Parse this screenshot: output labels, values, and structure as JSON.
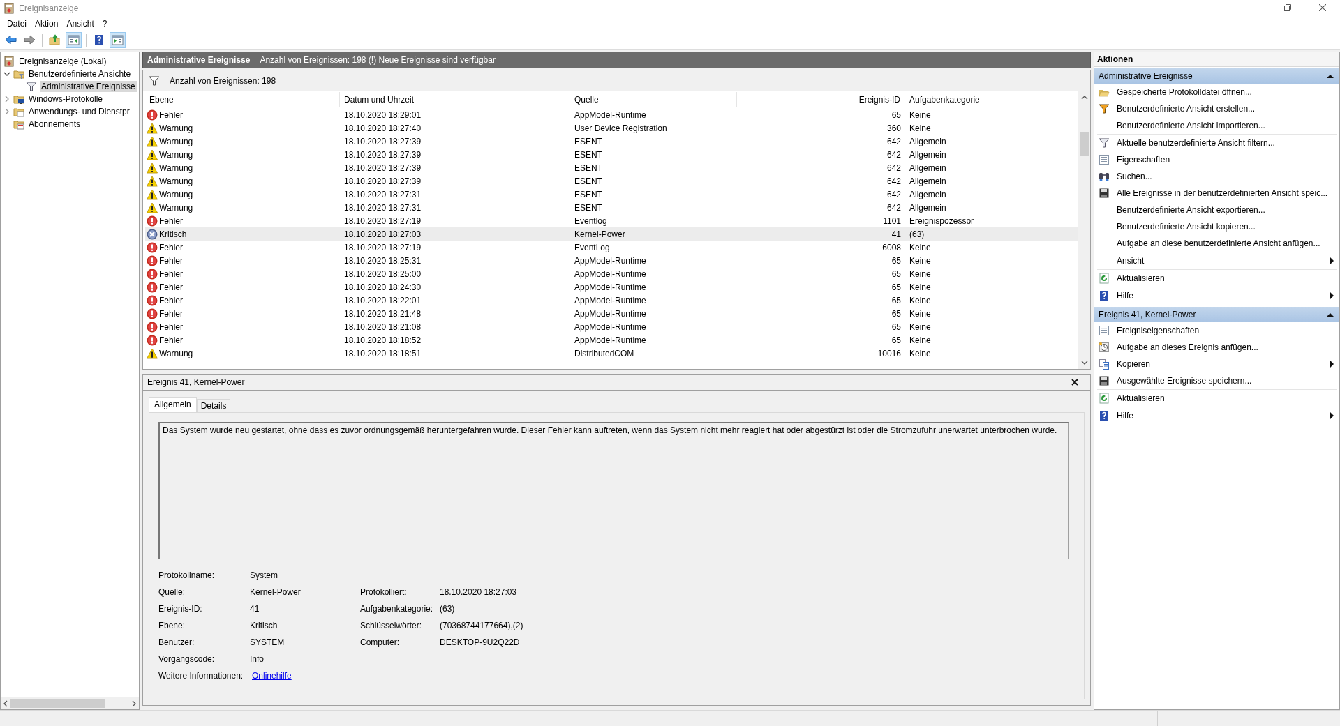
{
  "window": {
    "title": "Ereignisanzeige"
  },
  "menu": [
    "Datei",
    "Aktion",
    "Ansicht",
    "?"
  ],
  "toolbar": [
    {
      "kind": "back",
      "pressed": false
    },
    {
      "kind": "forward",
      "pressed": false
    },
    {
      "kind": "sep"
    },
    {
      "kind": "up-folder",
      "pressed": false
    },
    {
      "kind": "tree-pane",
      "pressed": true
    },
    {
      "kind": "sep"
    },
    {
      "kind": "help",
      "pressed": false
    },
    {
      "kind": "action-pane",
      "pressed": true
    }
  ],
  "tree": [
    {
      "label": "Ereignisanzeige (Lokal)",
      "kind": "log",
      "selected": false,
      "children": [
        {
          "label": "Benutzerdefinierte Ansichte",
          "kind": "folder-filter",
          "expanded": true,
          "selected": false,
          "children": [
            {
              "label": "Administrative Ereignisse",
              "kind": "funnel",
              "selected": true
            }
          ]
        },
        {
          "label": "Windows-Protokolle",
          "kind": "folder-pc",
          "expanded": false,
          "selected": false
        },
        {
          "label": "Anwendungs- und Dienstpr",
          "kind": "folder-doc",
          "expanded": false,
          "selected": false
        },
        {
          "label": "Abonnements",
          "kind": "folder-sub",
          "selected": false
        }
      ]
    }
  ],
  "view_header": {
    "title": "Administrative Ereignisse",
    "info": "Anzahl von Ereignissen: 198 (!) Neue Ereignisse sind verfügbar"
  },
  "filter_bar": {
    "text": "Anzahl von Ereignissen: 198"
  },
  "table": {
    "columns": [
      {
        "label": "Ebene"
      },
      {
        "label": "Datum und Uhrzeit"
      },
      {
        "label": "Quelle"
      },
      {
        "label": "Ereignis-ID"
      },
      {
        "label": "Aufgabenkategorie"
      }
    ],
    "rows": [
      {
        "kind": "error",
        "cells": [
          "Fehler",
          "18.10.2020 18:29:01",
          "AppModel-Runtime",
          "65",
          "Keine"
        ],
        "selected": false
      },
      {
        "kind": "warning",
        "cells": [
          "Warnung",
          "18.10.2020 18:27:40",
          "User Device Registration",
          "360",
          "Keine"
        ],
        "selected": false
      },
      {
        "kind": "warning",
        "cells": [
          "Warnung",
          "18.10.2020 18:27:39",
          "ESENT",
          "642",
          "Allgemein"
        ],
        "selected": false
      },
      {
        "kind": "warning",
        "cells": [
          "Warnung",
          "18.10.2020 18:27:39",
          "ESENT",
          "642",
          "Allgemein"
        ],
        "selected": false
      },
      {
        "kind": "warning",
        "cells": [
          "Warnung",
          "18.10.2020 18:27:39",
          "ESENT",
          "642",
          "Allgemein"
        ],
        "selected": false
      },
      {
        "kind": "warning",
        "cells": [
          "Warnung",
          "18.10.2020 18:27:39",
          "ESENT",
          "642",
          "Allgemein"
        ],
        "selected": false
      },
      {
        "kind": "warning",
        "cells": [
          "Warnung",
          "18.10.2020 18:27:31",
          "ESENT",
          "642",
          "Allgemein"
        ],
        "selected": false
      },
      {
        "kind": "warning",
        "cells": [
          "Warnung",
          "18.10.2020 18:27:31",
          "ESENT",
          "642",
          "Allgemein"
        ],
        "selected": false
      },
      {
        "kind": "error",
        "cells": [
          "Fehler",
          "18.10.2020 18:27:19",
          "Eventlog",
          "1101",
          "Ereignispozessor"
        ],
        "selected": false
      },
      {
        "kind": "critical",
        "cells": [
          "Kritisch",
          "18.10.2020 18:27:03",
          "Kernel-Power",
          "41",
          "(63)"
        ],
        "selected": true
      },
      {
        "kind": "error",
        "cells": [
          "Fehler",
          "18.10.2020 18:27:19",
          "EventLog",
          "6008",
          "Keine"
        ],
        "selected": false
      },
      {
        "kind": "error",
        "cells": [
          "Fehler",
          "18.10.2020 18:25:31",
          "AppModel-Runtime",
          "65",
          "Keine"
        ],
        "selected": false
      },
      {
        "kind": "error",
        "cells": [
          "Fehler",
          "18.10.2020 18:25:00",
          "AppModel-Runtime",
          "65",
          "Keine"
        ],
        "selected": false
      },
      {
        "kind": "error",
        "cells": [
          "Fehler",
          "18.10.2020 18:24:30",
          "AppModel-Runtime",
          "65",
          "Keine"
        ],
        "selected": false
      },
      {
        "kind": "error",
        "cells": [
          "Fehler",
          "18.10.2020 18:22:01",
          "AppModel-Runtime",
          "65",
          "Keine"
        ],
        "selected": false
      },
      {
        "kind": "error",
        "cells": [
          "Fehler",
          "18.10.2020 18:21:48",
          "AppModel-Runtime",
          "65",
          "Keine"
        ],
        "selected": false
      },
      {
        "kind": "error",
        "cells": [
          "Fehler",
          "18.10.2020 18:21:08",
          "AppModel-Runtime",
          "65",
          "Keine"
        ],
        "selected": false
      },
      {
        "kind": "error",
        "cells": [
          "Fehler",
          "18.10.2020 18:18:52",
          "AppModel-Runtime",
          "65",
          "Keine"
        ],
        "selected": false
      },
      {
        "kind": "warning",
        "cells": [
          "Warnung",
          "18.10.2020 18:18:51",
          "DistributedCOM",
          "10016",
          "Keine"
        ],
        "selected": false
      }
    ]
  },
  "details": {
    "title": "Ereignis 41, Kernel-Power",
    "tabs": [
      {
        "label": "Allgemein",
        "selected": true
      },
      {
        "label": "Details",
        "selected": false
      }
    ],
    "description": "Das System wurde neu gestartet, ohne dass es zuvor ordnungsgemäß heruntergefahren wurde. Dieser Fehler kann auftreten, wenn das System nicht mehr reagiert hat oder abgestürzt ist oder die Stromzufuhr unerwartet unterbrochen wurde.",
    "properties": [
      {
        "label": "Protokollname:",
        "value": "System"
      },
      {
        "label": "Quelle:",
        "value": "Kernel-Power",
        "label_2": "Protokolliert:",
        "value_2": "18.10.2020 18:27:03"
      },
      {
        "label": "Ereignis-ID:",
        "value": "41",
        "label_2": "Aufgabenkategorie:",
        "value_2": "(63)"
      },
      {
        "label": "Ebene:",
        "value": "Kritisch",
        "label_2": "Schlüsselwörter:",
        "value_2": "(70368744177664),(2)"
      },
      {
        "label": "Benutzer:",
        "value": "SYSTEM",
        "label_2": "Computer:",
        "value_2": "DESKTOP-9U2Q22D"
      },
      {
        "label": "Vorgangscode:",
        "value": "Info"
      },
      {
        "label": "Weitere Informationen:",
        "value": "Onlinehilfe",
        "kind": "link"
      }
    ]
  },
  "actions": {
    "title": "Aktionen",
    "sections": [
      {
        "title": "Administrative Ereignisse",
        "expanded": true,
        "groups": [
          [
            {
              "label": "Gespeicherte Protokolldatei öffnen...",
              "kind": "open-folder"
            },
            {
              "label": "Benutzerdefinierte Ansicht erstellen...",
              "kind": "funnel-color"
            },
            {
              "label": "Benutzerdefinierte Ansicht importieren..."
            }
          ],
          [
            {
              "label": "Aktuelle benutzerdefinierte Ansicht filtern...",
              "kind": "funnel"
            },
            {
              "label": "Eigenschaften",
              "kind": "properties"
            },
            {
              "label": "Suchen...",
              "kind": "binoculars"
            },
            {
              "label": "Alle Ereignisse in der benutzerdefinierten Ansicht speic...",
              "kind": "floppy"
            },
            {
              "label": "Benutzerdefinierte Ansicht exportieren..."
            },
            {
              "label": "Benutzerdefinierte Ansicht kopieren..."
            },
            {
              "label": "Aufgabe an diese benutzerdefinierte Ansicht anfügen..."
            }
          ],
          [
            {
              "label": "Ansicht",
              "submenu": true
            }
          ],
          [
            {
              "label": "Aktualisieren",
              "kind": "refresh"
            }
          ],
          [
            {
              "label": "Hilfe",
              "kind": "help",
              "submenu": true
            }
          ]
        ]
      },
      {
        "title": "Ereignis 41, Kernel-Power",
        "expanded": true,
        "groups": [
          [
            {
              "label": "Ereigniseigenschaften",
              "kind": "properties"
            },
            {
              "label": "Aufgabe an dieses Ereignis anfügen...",
              "kind": "clock-task"
            },
            {
              "label": "Kopieren",
              "kind": "copy",
              "submenu": true
            },
            {
              "label": "Ausgewählte Ereignisse speichern...",
              "kind": "floppy"
            }
          ],
          [
            {
              "label": "Aktualisieren",
              "kind": "refresh"
            }
          ],
          [
            {
              "label": "Hilfe",
              "kind": "help",
              "submenu": true
            }
          ]
        ]
      }
    ]
  }
}
